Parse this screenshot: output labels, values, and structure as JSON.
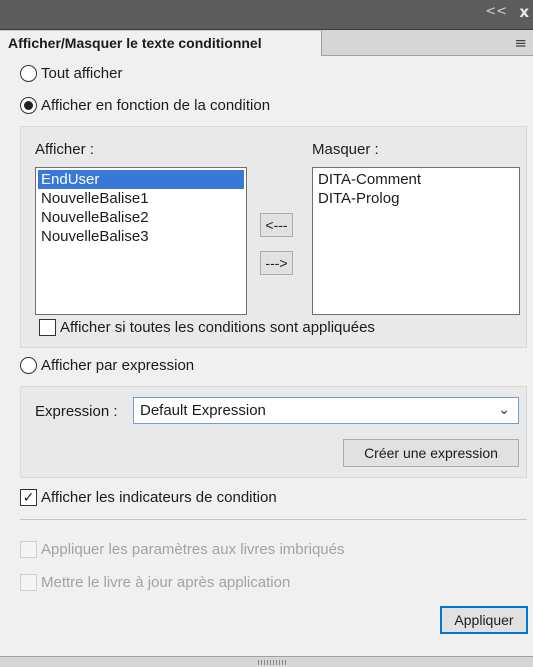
{
  "header": {
    "collapse_glyph": "<<",
    "close_glyph": "x",
    "tab_label": "Afficher/Masquer le texte conditionnel",
    "menu_glyph": "≡"
  },
  "options": {
    "show_all": "Tout afficher",
    "show_by_condition": "Afficher en fonction de la condition",
    "show_by_expression": "Afficher par expression",
    "selected": "show_by_condition"
  },
  "conditions": {
    "show_label": "Afficher :",
    "hide_label": "Masquer :",
    "show_items": [
      "EndUser",
      "NouvelleBalise1",
      "NouvelleBalise2",
      "NouvelleBalise3"
    ],
    "selected_show_item": "EndUser",
    "hide_items": [
      "DITA-Comment",
      "DITA-Prolog"
    ],
    "move_left_label": "<---",
    "move_right_label": "--->",
    "all_applied_label": "Afficher si toutes les conditions sont appliquées",
    "all_applied_checked": false
  },
  "expression": {
    "label": "Expression :",
    "value": "Default Expression",
    "create_button": "Créer une expression"
  },
  "indicators": {
    "label": "Afficher les indicateurs de condition",
    "checked": true,
    "check_glyph": "✓"
  },
  "book": {
    "apply_nested_label": "Appliquer les paramètres aux livres imbriqués",
    "update_after_label": "Mettre le livre à jour après application"
  },
  "apply_button": "Appliquer"
}
